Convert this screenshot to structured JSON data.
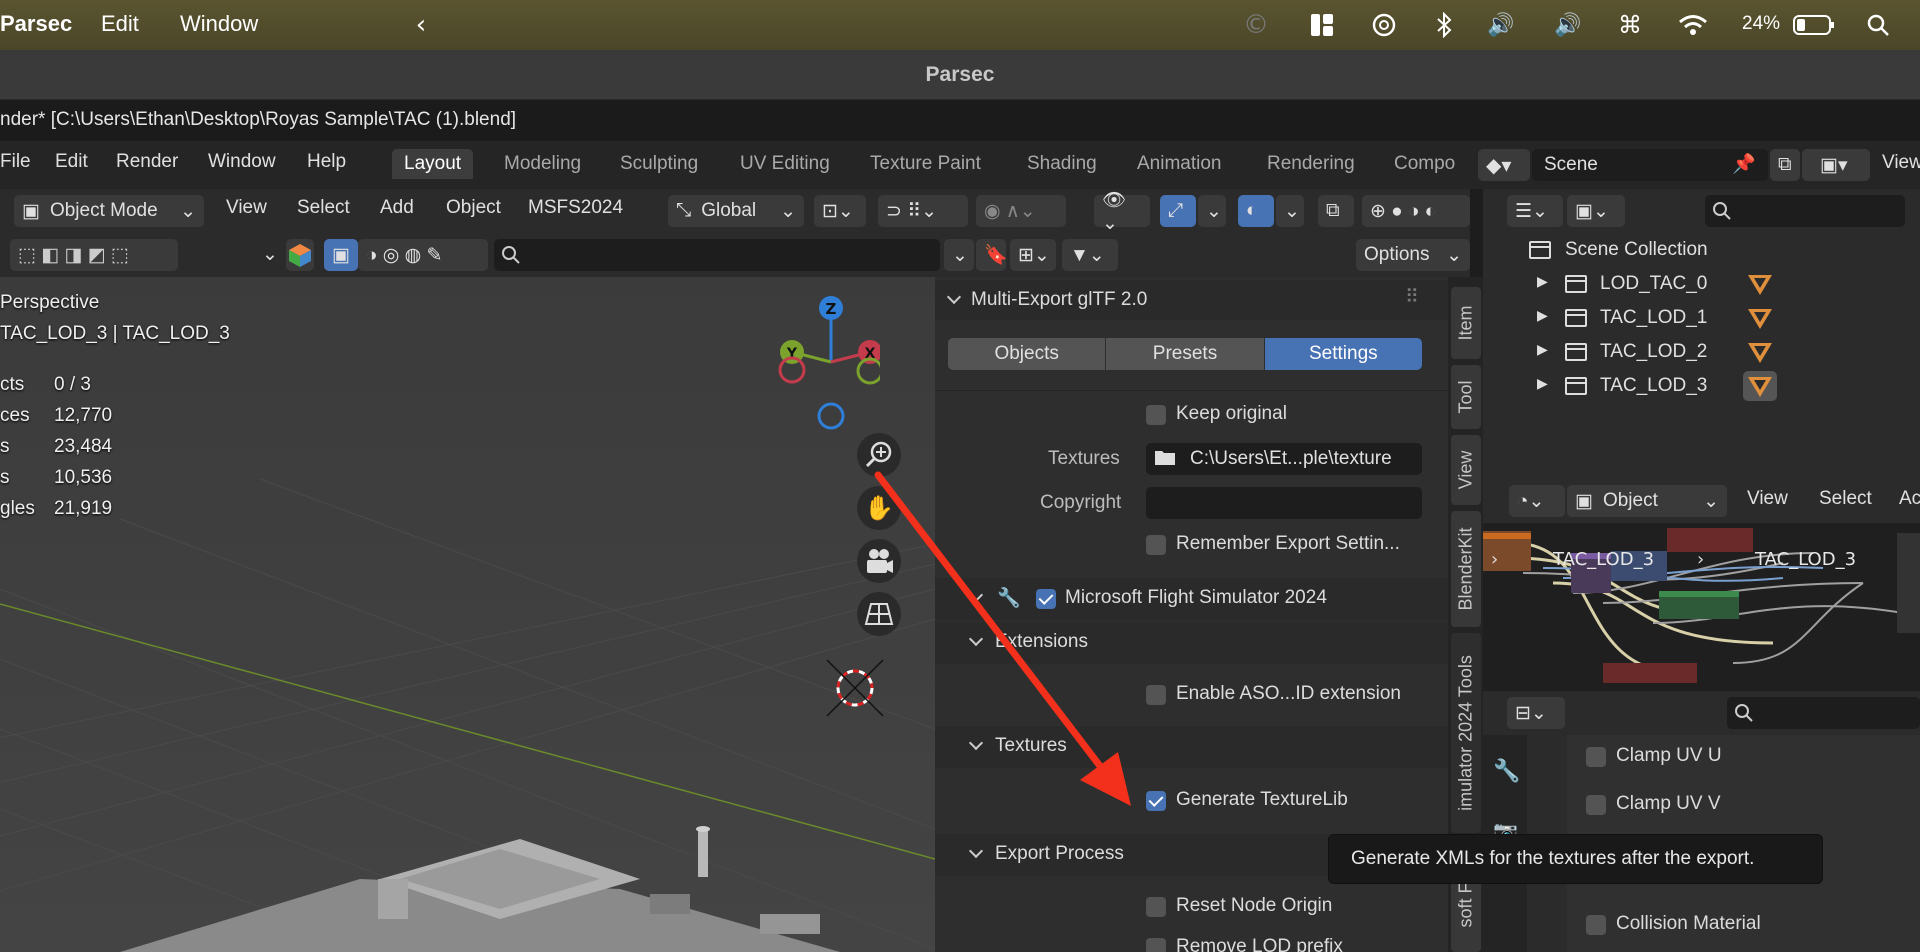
{
  "macos": {
    "app_name": "Parsec",
    "menus": [
      "Edit",
      "Window"
    ],
    "battery": "24%"
  },
  "parsec": {
    "title": "Parsec"
  },
  "window_title": "nder* [C:\\Users\\Ethan\\Desktop\\Royas Sample\\TAC (1).blend]",
  "blender_menus": [
    "File",
    "Edit",
    "Render",
    "Window",
    "Help"
  ],
  "workspace_tabs": [
    "Layout",
    "Modeling",
    "Sculpting",
    "UV Editing",
    "Texture Paint",
    "Shading",
    "Animation",
    "Rendering",
    "Compo"
  ],
  "scene": {
    "name": "Scene",
    "view_layer": "View"
  },
  "viewport_header": {
    "mode": "Object Mode",
    "menus": [
      "View",
      "Select",
      "Add",
      "Object",
      "MSFS2024"
    ],
    "orientation": "Global",
    "options": "Options"
  },
  "viewport_overlay": {
    "view_name": "Perspective",
    "collection": "TAC_LOD_3 | TAC_LOD_3",
    "stats": [
      {
        "label": "cts",
        "value": "0 / 3"
      },
      {
        "label": "ces",
        "value": "12,770"
      },
      {
        "label": "s",
        "value": "23,484"
      },
      {
        "label": "s",
        "value": "10,536"
      },
      {
        "label": "gles",
        "value": "21,919"
      }
    ],
    "gizmo_axes": {
      "z": "Z",
      "y": "Y",
      "x": "X"
    }
  },
  "export_panel": {
    "title": "Multi-Export glTF 2.0",
    "tabs": [
      "Objects",
      "Presets",
      "Settings"
    ],
    "active_tab": "Settings",
    "keep_original": {
      "label": "Keep original",
      "checked": false
    },
    "textures": {
      "label": "Textures",
      "value": "C:\\Users\\Et...ple\\texture"
    },
    "copyright": {
      "label": "Copyright",
      "value": ""
    },
    "remember": {
      "label": "Remember Export Settin...",
      "checked": false
    },
    "msfs": {
      "label": "Microsoft Flight Simulator 2024",
      "checked": true
    },
    "extensions_header": "Extensions",
    "aso_id": {
      "label": "Enable ASO...ID extension",
      "checked": false
    },
    "textures_header": "Textures",
    "texturelib": {
      "label": "Generate TextureLib",
      "checked": true
    },
    "export_process_header": "Export Process",
    "reset_node_origin": {
      "label": "Reset Node Origin",
      "checked": false
    },
    "remove_lod_prefix": {
      "label": "Remove LOD prefix",
      "checked": false
    }
  },
  "side_tabs": [
    "Item",
    "Tool",
    "View",
    "BlenderKit",
    "imulator 2024 Tools",
    "soft Flig"
  ],
  "outliner": {
    "root": "Scene Collection",
    "items": [
      "LOD_TAC_0",
      "TAC_LOD_1",
      "TAC_LOD_2",
      "TAC_LOD_3"
    ]
  },
  "node_editor": {
    "mode": "Object",
    "menus": [
      "View",
      "Select",
      "Ac"
    ],
    "breadcrumb": [
      "TAC_LOD_3",
      "TAC_LOD_3"
    ]
  },
  "properties": {
    "items": [
      {
        "label": "Clamp UV U",
        "checked": false
      },
      {
        "label": "Clamp UV V",
        "checked": false
      },
      {
        "label": "Collision Material",
        "checked": false
      }
    ]
  },
  "tooltip": "Generate XMLs for the textures after the export.",
  "colors": {
    "accent": "#4772b3",
    "arrow": "#f2301b",
    "lod_icon": "#e0903c"
  }
}
